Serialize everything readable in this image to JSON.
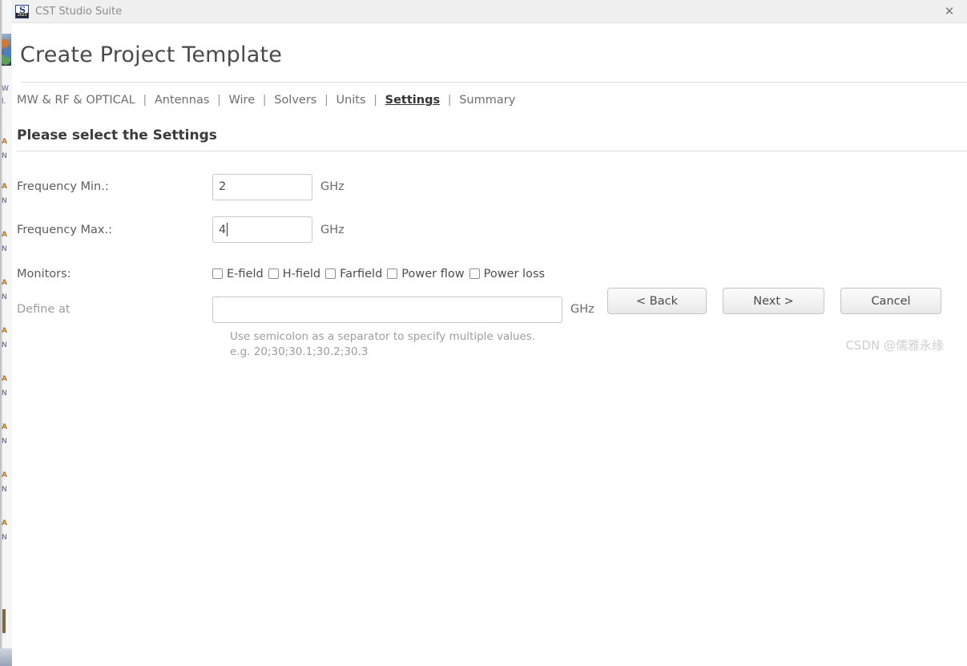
{
  "window": {
    "app_title": "CST Studio Suite",
    "icon_name": "cst-studio-suite-icon",
    "icon_glyph": "S",
    "icon_year": "2023",
    "close_label": "✕"
  },
  "page": {
    "title": "Create Project Template",
    "section_heading": "Please select the Settings"
  },
  "breadcrumb": {
    "separator": "|",
    "items": [
      {
        "label": "MW & RF & OPTICAL",
        "active": false
      },
      {
        "label": "Antennas",
        "active": false
      },
      {
        "label": "Wire",
        "active": false
      },
      {
        "label": "Solvers",
        "active": false
      },
      {
        "label": "Units",
        "active": false
      },
      {
        "label": "Settings",
        "active": true
      },
      {
        "label": "Summary",
        "active": false
      }
    ]
  },
  "form": {
    "freq_min": {
      "label": "Frequency Min.:",
      "value": "2",
      "unit": "GHz",
      "placeholder": ""
    },
    "freq_max": {
      "label": "Frequency Max.:",
      "value": "4",
      "unit": "GHz",
      "placeholder": "",
      "focused": true
    },
    "monitors": {
      "label": "Monitors:",
      "options": [
        {
          "label": "E-field",
          "checked": false
        },
        {
          "label": "H-field",
          "checked": false
        },
        {
          "label": "Farfield",
          "checked": false
        },
        {
          "label": "Power flow",
          "checked": false
        },
        {
          "label": "Power loss",
          "checked": false
        }
      ]
    },
    "define_at": {
      "label": "Define at",
      "value": "",
      "unit": "GHz",
      "placeholder": "",
      "hint_line1": "Use semicolon as a separator to specify multiple values.",
      "hint_line2": "e.g. 20;30;30.1;30.2;30.3"
    }
  },
  "buttons": {
    "back": "< Back",
    "next": "Next >",
    "cancel": "Cancel"
  },
  "watermark": "CSDN @儒雅永缘",
  "background_window": {
    "rows": [
      "MW",
      "Ant",
      "MW",
      "Ant",
      "MW",
      "Ant",
      "MW",
      "Ant",
      "MW",
      "Ant",
      "MW",
      "Ant",
      "MW"
    ]
  },
  "colors": {
    "accent": "#1d3b8f",
    "title_gray": "#4a4a4a",
    "label_gray": "#5c5c5c",
    "dim_gray": "#9d9d9d",
    "border": "#c8c8c8",
    "titlebar_bg": "#f0f0f0"
  }
}
